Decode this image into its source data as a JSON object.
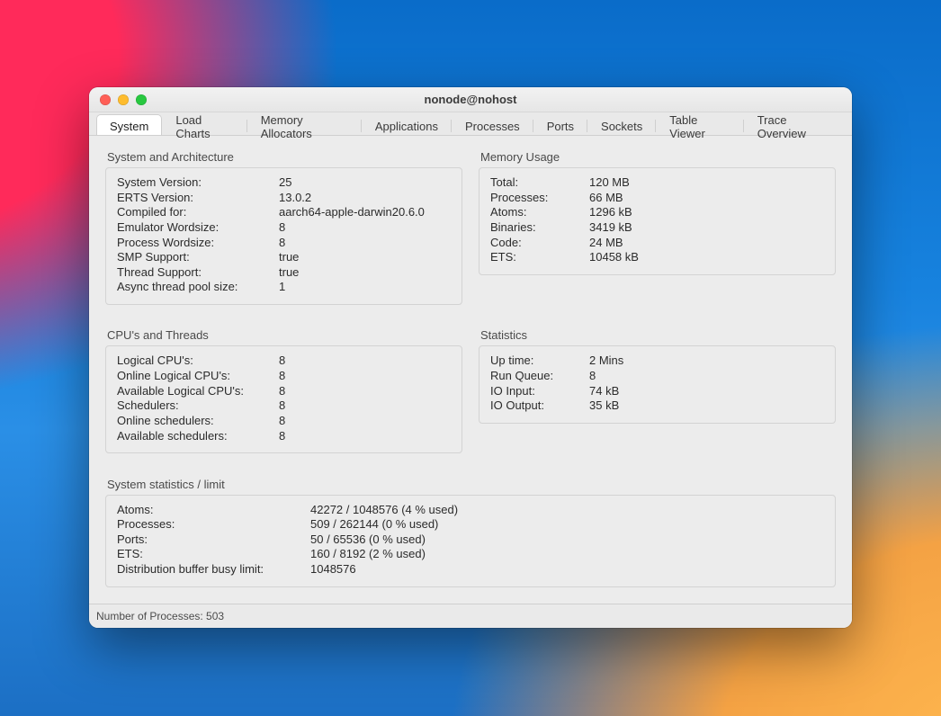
{
  "window": {
    "title": "nonode@nohost"
  },
  "tabs": [
    {
      "label": "System",
      "active": true
    },
    {
      "label": "Load Charts"
    },
    {
      "label": "Memory Allocators"
    },
    {
      "label": "Applications"
    },
    {
      "label": "Processes"
    },
    {
      "label": "Ports"
    },
    {
      "label": "Sockets"
    },
    {
      "label": "Table Viewer"
    },
    {
      "label": "Trace Overview"
    }
  ],
  "arch": {
    "heading": "System and Architecture",
    "rows": [
      {
        "k": "System Version:",
        "v": "25"
      },
      {
        "k": "ERTS Version:",
        "v": "13.0.2"
      },
      {
        "k": "Compiled for:",
        "v": "aarch64-apple-darwin20.6.0"
      },
      {
        "k": "Emulator Wordsize:",
        "v": "8"
      },
      {
        "k": "Process Wordsize:",
        "v": "8"
      },
      {
        "k": "SMP Support:",
        "v": "true"
      },
      {
        "k": "Thread Support:",
        "v": "true"
      },
      {
        "k": "Async thread pool size:",
        "v": "1"
      }
    ]
  },
  "mem": {
    "heading": "Memory Usage",
    "rows": [
      {
        "k": "Total:",
        "v": "120 MB"
      },
      {
        "k": "Processes:",
        "v": "66 MB"
      },
      {
        "k": "Atoms:",
        "v": "1296 kB"
      },
      {
        "k": "Binaries:",
        "v": "3419 kB"
      },
      {
        "k": "Code:",
        "v": "24 MB"
      },
      {
        "k": "ETS:",
        "v": "10458 kB"
      }
    ]
  },
  "cpu": {
    "heading": "CPU's and Threads",
    "rows": [
      {
        "k": "Logical CPU's:",
        "v": "8"
      },
      {
        "k": "Online Logical CPU's:",
        "v": "8"
      },
      {
        "k": "Available Logical CPU's:",
        "v": "8"
      },
      {
        "k": "Schedulers:",
        "v": "8"
      },
      {
        "k": "Online schedulers:",
        "v": "8"
      },
      {
        "k": "Available schedulers:",
        "v": "8"
      }
    ]
  },
  "stats": {
    "heading": "Statistics",
    "rows": [
      {
        "k": "Up time:",
        "v": "2 Mins"
      },
      {
        "k": "Run Queue:",
        "v": "8"
      },
      {
        "k": "IO Input:",
        "v": "74 kB"
      },
      {
        "k": "IO Output:",
        "v": "35 kB"
      }
    ]
  },
  "limits": {
    "heading": "System statistics / limit",
    "rows": [
      {
        "k": "Atoms:",
        "v": "42272 / 1048576 (4 % used)"
      },
      {
        "k": "Processes:",
        "v": "509 / 262144 (0 % used)"
      },
      {
        "k": "Ports:",
        "v": "50 / 65536 (0 % used)"
      },
      {
        "k": "ETS:",
        "v": "160 / 8192 (2 % used)"
      },
      {
        "k": "Distribution buffer busy limit:",
        "v": "1048576"
      }
    ]
  },
  "statusbar": {
    "text": "Number of Processes: 503"
  }
}
